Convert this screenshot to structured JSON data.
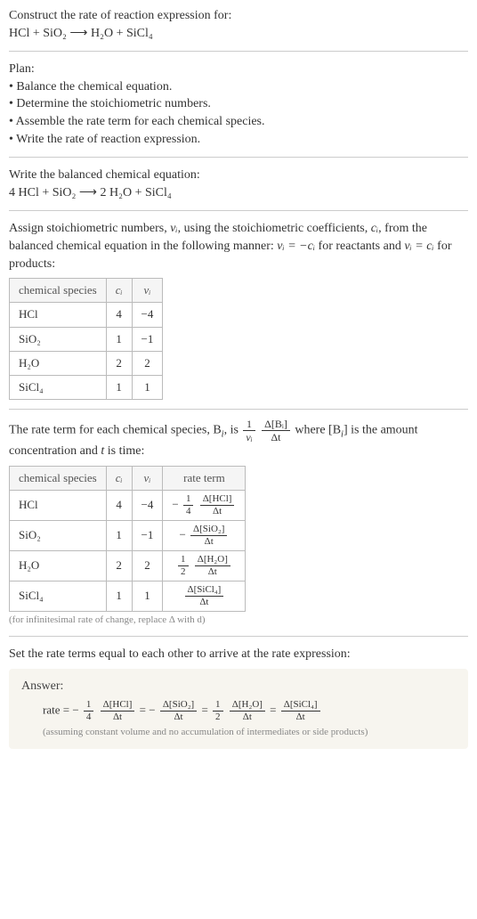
{
  "intro": {
    "construct_line": "Construct the rate of reaction expression for:",
    "unbalanced_eq": "HCl + SiO₂ ⟶ H₂O + SiCl₄"
  },
  "plan": {
    "heading": "Plan:",
    "items": [
      "• Balance the chemical equation.",
      "• Determine the stoichiometric numbers.",
      "• Assemble the rate term for each chemical species.",
      "• Write the rate of reaction expression."
    ]
  },
  "balanced": {
    "heading": "Write the balanced chemical equation:",
    "eq": "4 HCl + SiO₂ ⟶ 2 H₂O + SiCl₄"
  },
  "assign": {
    "text_a": "Assign stoichiometric numbers, ",
    "nu_i": "νᵢ",
    "text_b": ", using the stoichiometric coefficients, ",
    "c_i": "cᵢ",
    "text_c": ", from the balanced chemical equation in the following manner: ",
    "rel_reactants": "νᵢ = −cᵢ",
    "text_d": " for reactants and ",
    "rel_products": "νᵢ = cᵢ",
    "text_e": " for products:"
  },
  "table1": {
    "headers": [
      "chemical species",
      "cᵢ",
      "νᵢ"
    ],
    "rows": [
      {
        "species": "HCl",
        "c": "4",
        "nu": "−4"
      },
      {
        "species": "SiO₂",
        "c": "1",
        "nu": "−1"
      },
      {
        "species": "H₂O",
        "c": "2",
        "nu": "2"
      },
      {
        "species": "SiCl₄",
        "c": "1",
        "nu": "1"
      }
    ]
  },
  "rateterm": {
    "text_a": "The rate term for each chemical species, B",
    "text_b": ", is ",
    "frac1_num": "1",
    "frac1_den": "νᵢ",
    "frac2_num": "Δ[Bᵢ]",
    "frac2_den": "Δt",
    "text_c": " where [B",
    "text_d": "] is the amount concentration and ",
    "t": "t",
    "text_e": " is time:"
  },
  "table2": {
    "headers": [
      "chemical species",
      "cᵢ",
      "νᵢ",
      "rate term"
    ],
    "rows": [
      {
        "species": "HCl",
        "c": "4",
        "nu": "−4",
        "sign": "−",
        "coef_num": "1",
        "coef_den": "4",
        "top": "Δ[HCl]",
        "bot": "Δt"
      },
      {
        "species": "SiO₂",
        "c": "1",
        "nu": "−1",
        "sign": "−",
        "coef_num": "",
        "coef_den": "",
        "top": "Δ[SiO₂]",
        "bot": "Δt"
      },
      {
        "species": "H₂O",
        "c": "2",
        "nu": "2",
        "sign": "",
        "coef_num": "1",
        "coef_den": "2",
        "top": "Δ[H₂O]",
        "bot": "Δt"
      },
      {
        "species": "SiCl₄",
        "c": "1",
        "nu": "1",
        "sign": "",
        "coef_num": "",
        "coef_den": "",
        "top": "Δ[SiCl₄]",
        "bot": "Δt"
      }
    ],
    "note": "(for infinitesimal rate of change, replace Δ with d)"
  },
  "conclusion": {
    "text": "Set the rate terms equal to each other to arrive at the rate expression:"
  },
  "answer": {
    "label": "Answer:",
    "prefix": "rate = ",
    "terms": [
      {
        "sign": "−",
        "coef_num": "1",
        "coef_den": "4",
        "top": "Δ[HCl]",
        "bot": "Δt"
      },
      {
        "sign": "−",
        "coef_num": "",
        "coef_den": "",
        "top": "Δ[SiO₂]",
        "bot": "Δt"
      },
      {
        "sign": "",
        "coef_num": "1",
        "coef_den": "2",
        "top": "Δ[H₂O]",
        "bot": "Δt"
      },
      {
        "sign": "",
        "coef_num": "",
        "coef_den": "",
        "top": "Δ[SiCl₄]",
        "bot": "Δt"
      }
    ],
    "eq_sep": " = ",
    "assumption": "(assuming constant volume and no accumulation of intermediates or side products)"
  },
  "chart_data": {
    "type": "table",
    "tables": [
      {
        "title": "Stoichiometric numbers",
        "columns": [
          "chemical species",
          "c_i",
          "nu_i"
        ],
        "rows": [
          [
            "HCl",
            4,
            -4
          ],
          [
            "SiO2",
            1,
            -1
          ],
          [
            "H2O",
            2,
            2
          ],
          [
            "SiCl4",
            1,
            1
          ]
        ]
      },
      {
        "title": "Rate terms",
        "columns": [
          "chemical species",
          "c_i",
          "nu_i",
          "rate term"
        ],
        "rows": [
          [
            "HCl",
            4,
            -4,
            "-(1/4) Δ[HCl]/Δt"
          ],
          [
            "SiO2",
            1,
            -1,
            "- Δ[SiO2]/Δt"
          ],
          [
            "H2O",
            2,
            2,
            "(1/2) Δ[H2O]/Δt"
          ],
          [
            "SiCl4",
            1,
            1,
            "Δ[SiCl4]/Δt"
          ]
        ]
      }
    ]
  }
}
